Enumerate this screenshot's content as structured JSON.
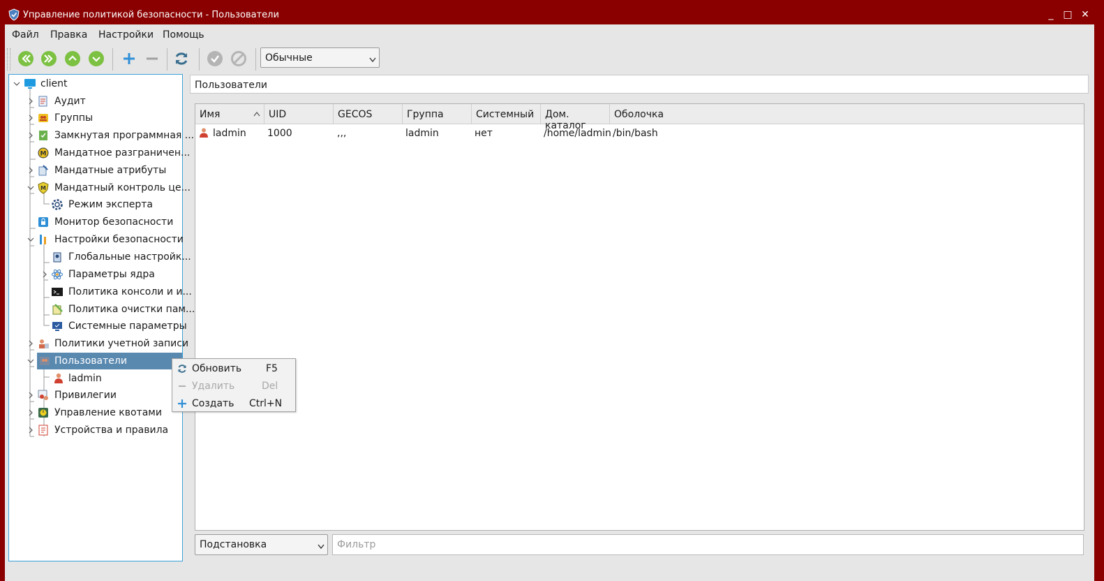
{
  "window": {
    "title": "Управление политикой безопасности - Пользователи",
    "controls": {
      "minimize": "_",
      "maximize": "□",
      "close": "✕"
    }
  },
  "menu": [
    "Файл",
    "Правка",
    "Настройки",
    "Помощь"
  ],
  "toolbar": {
    "buttons": [
      "first-icon",
      "last-icon",
      "up-icon",
      "down-icon",
      "add-icon",
      "remove-icon",
      "refresh-icon",
      "apply-icon",
      "cancel-icon"
    ],
    "mode_value": "Обычные"
  },
  "tree": {
    "root": "client",
    "items": [
      {
        "label": "Аудит"
      },
      {
        "label": "Группы"
      },
      {
        "label": "Замкнутая программная ..."
      },
      {
        "label": "Мандатное разграничен..."
      },
      {
        "label": "Мандатные атрибуты"
      },
      {
        "label": "Мандатный контроль це..."
      },
      {
        "label": "Режим эксперта"
      },
      {
        "label": "Монитор безопасности"
      },
      {
        "label": "Настройки безопасности"
      },
      {
        "label": "Глобальные настройк..."
      },
      {
        "label": "Параметры ядра"
      },
      {
        "label": "Политика консоли и и..."
      },
      {
        "label": "Политика очистки пам..."
      },
      {
        "label": "Системные параметры"
      },
      {
        "label": "Политики учетной записи"
      },
      {
        "label": "Пользователи"
      },
      {
        "label": "ladmin"
      },
      {
        "label": "Привилегии"
      },
      {
        "label": "Управление квотами"
      },
      {
        "label": "Устройства и правила"
      }
    ]
  },
  "content": {
    "path": "Пользователи",
    "columns": [
      "Имя",
      "UID",
      "GECOS",
      "Группа",
      "Системный",
      "Дом. каталог",
      "Оболочка"
    ],
    "rows": [
      {
        "name": "ladmin",
        "uid": "1000",
        "gecos": ",,,",
        "group": "ladmin",
        "system": "нет",
        "home": "/home/ladmin",
        "shell": "/bin/bash"
      }
    ],
    "search_mode": "Подстановка",
    "filter_placeholder": "Фильтр"
  },
  "context_menu": {
    "items": [
      {
        "label": "Обновить",
        "shortcut": "F5",
        "enabled": true
      },
      {
        "label": "Удалить",
        "shortcut": "Del",
        "enabled": false
      },
      {
        "label": "Создать",
        "shortcut": "Ctrl+N",
        "enabled": true
      }
    ]
  },
  "colors": {
    "titlebar": "#8a0000",
    "accent_green": "#7cc142",
    "accent_blue": "#2f8fd6",
    "selection": "#5a89b0"
  }
}
